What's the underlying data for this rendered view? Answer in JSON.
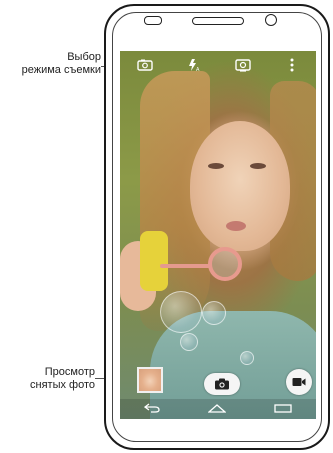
{
  "callouts": {
    "mode_select": {
      "line1": "Выбор",
      "line2": "режима съемки"
    },
    "view_photos": {
      "line1": "Просмотр",
      "line2": "снятых фото"
    }
  },
  "phone": {
    "screen": {
      "top_icons": [
        "camera-mode-icon",
        "flash-auto-icon",
        "switch-camera-icon",
        "more-vertical-icon"
      ],
      "bottom_controls": [
        "gallery-thumbnail",
        "shutter-button",
        "video-record-button"
      ],
      "nav_icons": [
        "back-icon",
        "home-icon",
        "recent-apps-icon"
      ]
    }
  },
  "colors": {
    "ui_icon": "#ffffff",
    "button_bg": "#f5f5f5",
    "phone_outline": "#1a1a1a"
  }
}
